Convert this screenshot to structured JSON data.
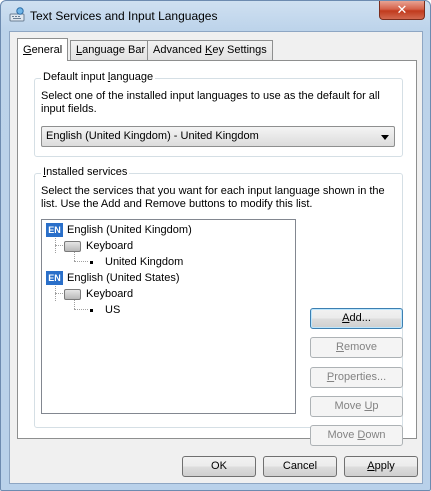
{
  "window": {
    "title": "Text Services and Input Languages",
    "close_label": "✕"
  },
  "tabs": [
    {
      "pre": "",
      "mn": "G",
      "post": "eneral"
    },
    {
      "pre": "",
      "mn": "L",
      "post": "anguage Bar"
    },
    {
      "pre": "Advanced ",
      "mn": "K",
      "post": "ey Settings"
    }
  ],
  "default_input": {
    "label_pre": "Default input ",
    "label_mn": "l",
    "label_post": "anguage",
    "description": "Select one of the installed input languages to use as the default for all input fields.",
    "selected_value": "English (United Kingdom) - United Kingdom"
  },
  "installed_services": {
    "label_pre": "",
    "label_mn": "I",
    "label_post": "nstalled services",
    "description": "Select the services that you want for each input language shown in the list. Use the Add and Remove buttons to modify this list.",
    "tree": [
      {
        "lang_code": "EN",
        "language": "English (United Kingdom)",
        "category": "Keyboard",
        "service": "United Kingdom"
      },
      {
        "lang_code": "EN",
        "language": "English (United States)",
        "category": "Keyboard",
        "service": "US"
      }
    ],
    "buttons": {
      "add": {
        "pre": "",
        "mn": "A",
        "post": "dd..."
      },
      "remove": {
        "pre": "",
        "mn": "R",
        "post": "emove"
      },
      "properties": {
        "pre": "",
        "mn": "P",
        "post": "roperties..."
      },
      "move_up": {
        "pre": "Move ",
        "mn": "U",
        "post": "p"
      },
      "move_down": {
        "pre": "Move ",
        "mn": "D",
        "post": "own"
      }
    }
  },
  "footer": {
    "ok": "OK",
    "cancel": "Cancel",
    "apply_pre": "",
    "apply_mn": "A",
    "apply_post": "pply"
  }
}
